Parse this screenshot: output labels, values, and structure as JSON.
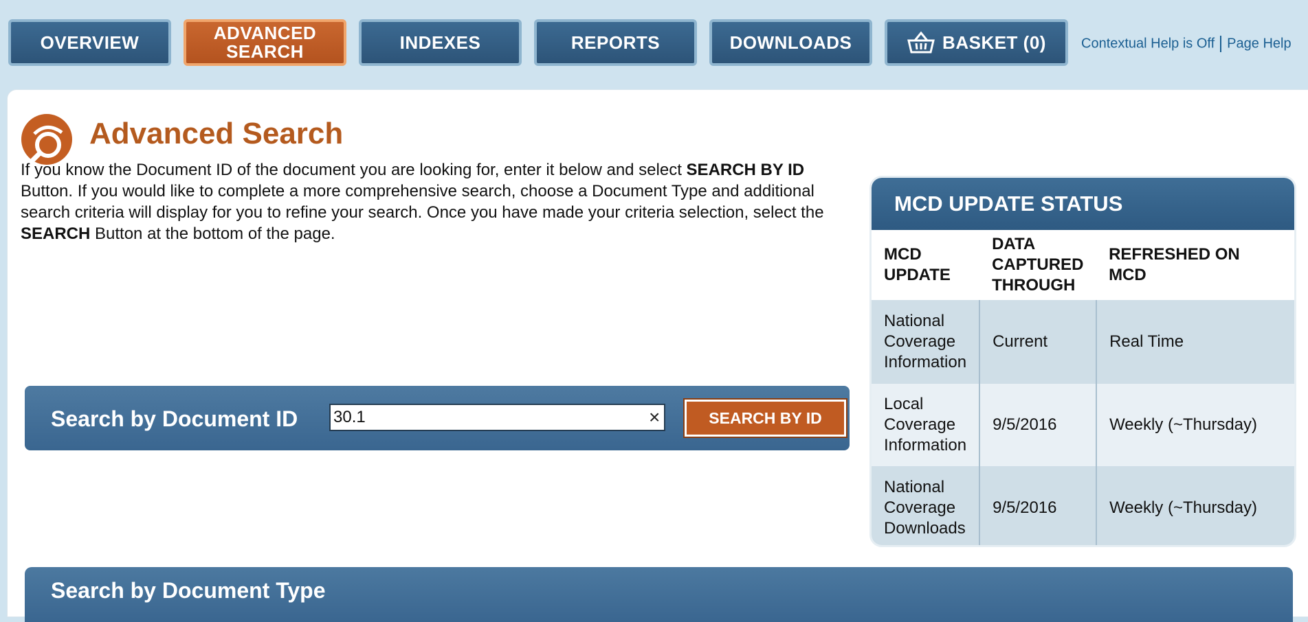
{
  "nav": {
    "overview": "OVERVIEW",
    "advanced_search_line1": "ADVANCED",
    "advanced_search_line2": "SEARCH",
    "indexes": "INDEXES",
    "reports": "REPORTS",
    "downloads": "DOWNLOADS",
    "basket": "BASKET (0)",
    "active_tab": "ADVANCED SEARCH",
    "active_color": "#c05b22",
    "tab_color": "#2d5478"
  },
  "help": {
    "contextual": "Contextual Help is Off",
    "page": "Page Help"
  },
  "page": {
    "title": "Advanced Search",
    "title_color": "#b45a1e",
    "intro_1": "If you know the Document ID of the document you are looking for, enter it below and select ",
    "intro_b1": "SEARCH BY ID",
    "intro_2": " Button. If you would like to complete a more comprehensive search, choose a Document Type and additional search criteria will display for you to refine your search. Once you have made your criteria selection, select the ",
    "intro_b2": "SEARCH",
    "intro_3": " Button at the bottom of the page."
  },
  "search_by_id": {
    "label": "Search by Document ID",
    "value": "30.1",
    "clear": "×",
    "button": "SEARCH BY ID"
  },
  "mcd_status": {
    "title": "MCD UPDATE STATUS",
    "headers": [
      "MCD UPDATE",
      "DATA CAPTURED THROUGH",
      "REFRESHED ON MCD"
    ],
    "rows": [
      [
        "National Coverage Information",
        "Current",
        "Real Time"
      ],
      [
        "Local Coverage Information",
        "9/5/2016",
        "Weekly (~Thursday)"
      ],
      [
        "National Coverage Downloads",
        "9/5/2016",
        "Weekly (~Thursday)"
      ]
    ]
  },
  "search_by_type": {
    "label": "Search by Document Type"
  },
  "icons": {
    "basket": "basket-icon",
    "title": "search-magnifier-icon"
  }
}
